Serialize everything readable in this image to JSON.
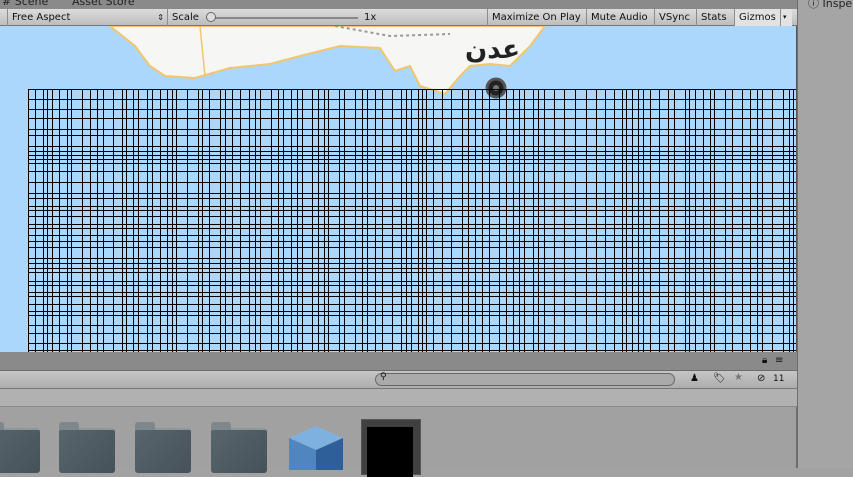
{
  "tabs": {
    "scene": "# Scene",
    "asset_store": "Asset Store"
  },
  "toolbar": {
    "aspect": "Free Aspect",
    "scale_label": "Scale",
    "scale_value": "1x",
    "scale_fraction": 0,
    "maximize": "Maximize On Play",
    "mute": "Mute Audio",
    "vsync": "VSync",
    "stats": "Stats",
    "gizmos": "Gizmos"
  },
  "inspector": {
    "tab": "Inspe"
  },
  "map": {
    "label": "عدن"
  },
  "project": {
    "search_placeholder": "",
    "hidden_count": "11"
  },
  "colors": {
    "water": "#aad7fb",
    "land": "#f6f6f4",
    "road": "#f3c66b"
  }
}
